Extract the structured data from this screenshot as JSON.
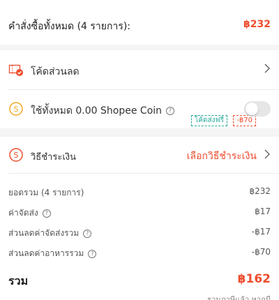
{
  "orders": {
    "label": "คำสั่งซื้อทั้งหมด (4 รายการ):",
    "total": "฿232"
  },
  "voucher": {
    "label": "โค้ดส่วนลด",
    "free_ship_tag": "โค้ดส่งฟรี",
    "discount_tag": "-฿70"
  },
  "coin": {
    "label": "ใช้ทั้งหมด 0.00 Shopee Coin",
    "enabled": false
  },
  "payment": {
    "label": "วิธีชำระเงิน",
    "select_label": "เลือกวิธีชำระเงิน"
  },
  "summary": {
    "rows": [
      {
        "label": "ยอดรวม (4 รายการ)",
        "value": "฿232"
      },
      {
        "label": "ค่าจัดส่ง",
        "value": "฿17"
      },
      {
        "label": "ส่วนลดค่าจัดส่งรวม",
        "value": "-฿17"
      },
      {
        "label": "ส่วนลดค่าอาหารรวม",
        "value": "-฿70"
      }
    ],
    "total_label": "รวม",
    "total_value": "฿162",
    "footnote": "รวมภาษีแล้ว หากมี"
  },
  "colors": {
    "accent": "#ee4d2d",
    "teal": "#26aa99",
    "coin": "#f5a623"
  }
}
